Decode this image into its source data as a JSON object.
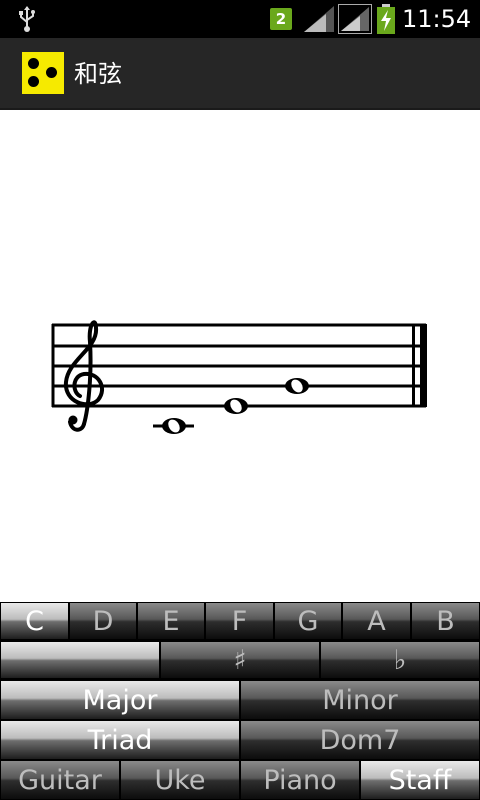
{
  "status_bar": {
    "notification_count": "2",
    "time": "11:54",
    "icons": [
      "usb-icon",
      "notification-badge",
      "signal-icon",
      "signal-icon",
      "battery-charging-icon"
    ]
  },
  "action_bar": {
    "title": "和弦",
    "icon": "braille-dots-icon",
    "icon_color": "#f6ea00"
  },
  "staff": {
    "clef": "treble",
    "notes": [
      "C4",
      "E4",
      "G4"
    ],
    "chord_type": "whole-note chord"
  },
  "keyboard": {
    "notes": [
      {
        "label": "C",
        "selected": true
      },
      {
        "label": "D",
        "selected": false
      },
      {
        "label": "E",
        "selected": false
      },
      {
        "label": "F",
        "selected": false
      },
      {
        "label": "G",
        "selected": false
      },
      {
        "label": "A",
        "selected": false
      },
      {
        "label": "B",
        "selected": false
      }
    ],
    "accidentals": [
      {
        "label": "",
        "selected": true
      },
      {
        "label": "♯",
        "selected": false
      },
      {
        "label": "♭",
        "selected": false
      }
    ],
    "qualities": [
      {
        "label": "Major",
        "selected": true
      },
      {
        "label": "Minor",
        "selected": false
      }
    ],
    "types": [
      {
        "label": "Triad",
        "selected": true
      },
      {
        "label": "Dom7",
        "selected": false
      }
    ],
    "views": [
      {
        "label": "Guitar",
        "selected": false
      },
      {
        "label": "Uke",
        "selected": false
      },
      {
        "label": "Piano",
        "selected": false
      },
      {
        "label": "Staff",
        "selected": true
      }
    ]
  }
}
